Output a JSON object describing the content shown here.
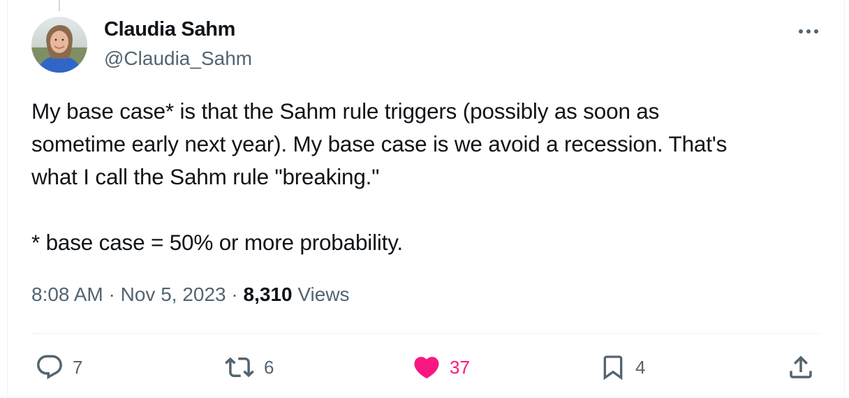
{
  "tweet": {
    "author": {
      "name": "Claudia Sahm",
      "handle": "@Claudia_Sahm",
      "avatar_icon": "profile-photo"
    },
    "text_lines": [
      "My base case* is that the Sahm rule triggers (possibly as soon as",
      "sometime early next year). My base case is we avoid a recession. That's",
      "what I call the Sahm rule \"breaking.\"",
      "* base case = 50% or more probability."
    ],
    "meta": {
      "time": "8:08 AM",
      "separator": "·",
      "date": "Nov 5, 2023",
      "views_count": "8,310",
      "views_label": "Views"
    },
    "actions": {
      "replies": "7",
      "retweets": "6",
      "likes": "37",
      "bookmarks": "4"
    }
  },
  "colors": {
    "text": "#0f1419",
    "secondary": "#536471",
    "like": "#f91880",
    "border": "#eff3f4"
  }
}
